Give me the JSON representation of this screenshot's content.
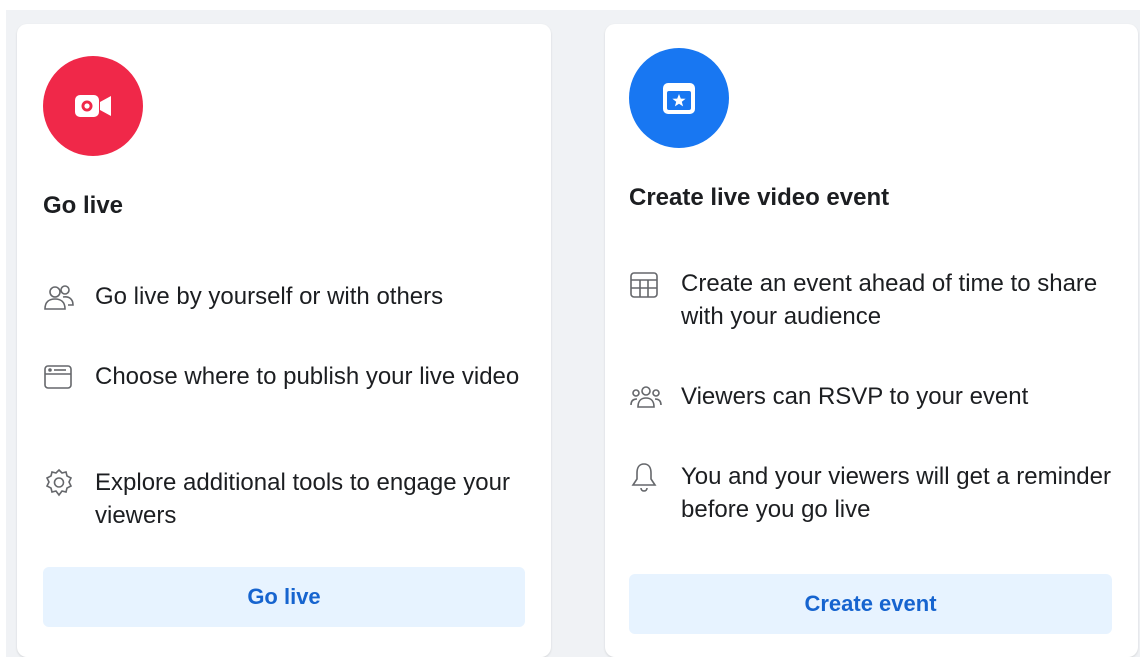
{
  "colors": {
    "go_live_icon_bg": "#f02849",
    "event_icon_bg": "#1877f2",
    "button_bg": "#e7f3ff",
    "button_text": "#1664cf"
  },
  "go_live_card": {
    "icon": "video-camera-icon",
    "title": "Go live",
    "features": [
      {
        "icon": "people-icon",
        "text": "Go live by yourself or with others"
      },
      {
        "icon": "browser-window-icon",
        "text": "Choose where to publish your live video"
      },
      {
        "icon": "gear-icon",
        "text": "Explore additional tools to engage your viewers"
      }
    ],
    "button_label": "Go live"
  },
  "event_card": {
    "icon": "calendar-star-icon",
    "title": "Create live video event",
    "features": [
      {
        "icon": "calendar-grid-icon",
        "text": "Create an event ahead of time to share with your audience"
      },
      {
        "icon": "group-icon",
        "text": "Viewers can RSVP to your event"
      },
      {
        "icon": "bell-icon",
        "text": "You and your viewers will get a reminder before you go live"
      }
    ],
    "button_label": "Create event"
  }
}
